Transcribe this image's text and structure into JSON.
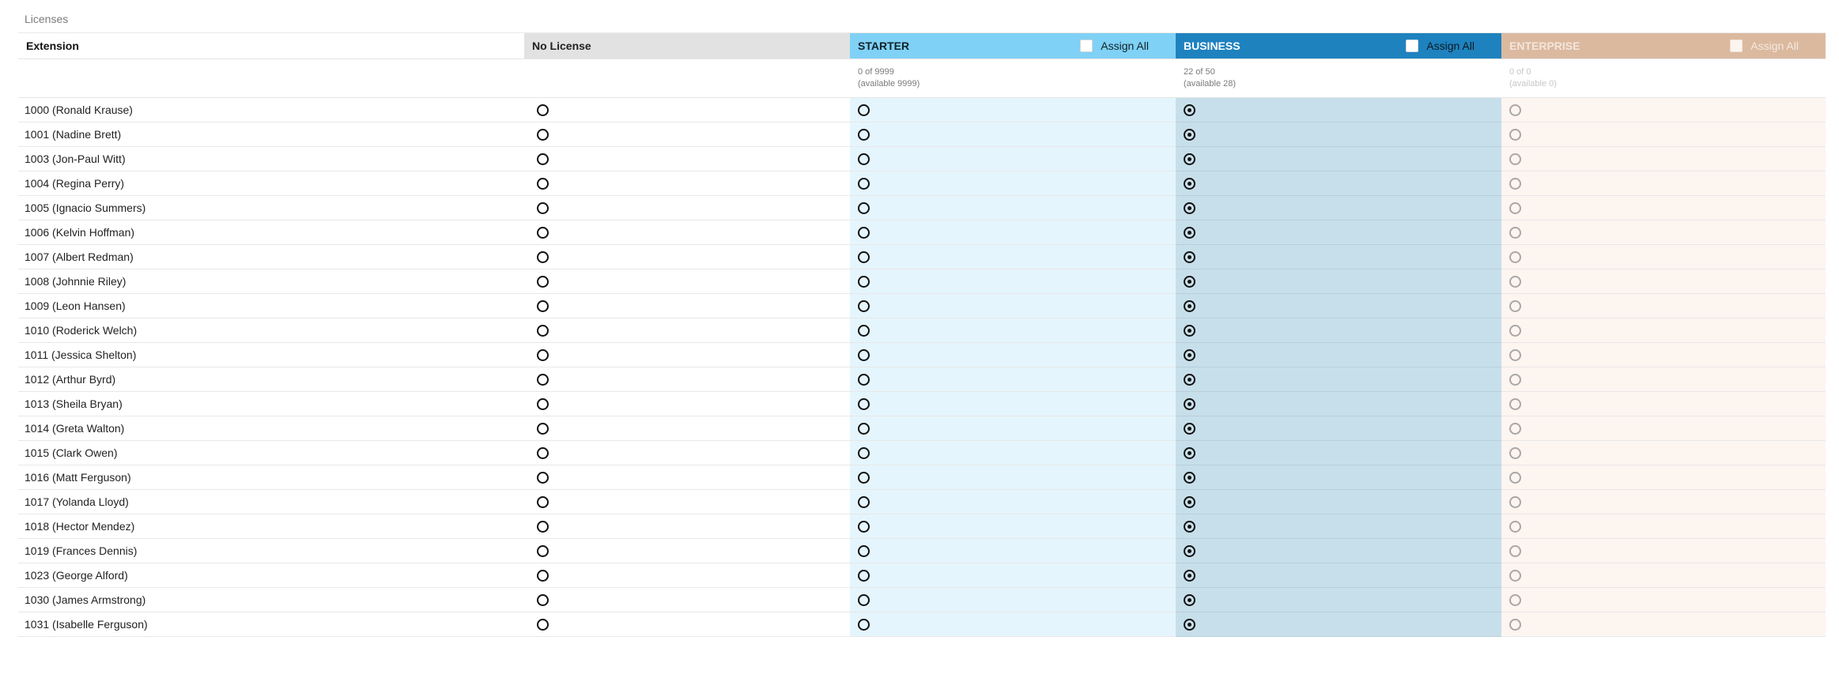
{
  "section_title": "Licenses",
  "headers": {
    "extension": "Extension",
    "none": "No License",
    "starter": "STARTER",
    "business": "BUSINESS",
    "enterprise": "ENTERPRISE",
    "assign_all": "Assign All"
  },
  "colors": {
    "starter": "#7fd1f5",
    "business": "#1e82bf",
    "enterprise": "#dbb99f",
    "no_license": "#e2e2e2"
  },
  "counts": {
    "starter": {
      "used": "0 of 9999",
      "available": "(available 9999)"
    },
    "business": {
      "used": "22 of 50",
      "available": "(available 28)"
    },
    "enterprise": {
      "used": "0 of 0",
      "available": "(available 0)"
    }
  },
  "rows": [
    {
      "extension": "1000 (Ronald Krause)",
      "license": "business"
    },
    {
      "extension": "1001 (Nadine Brett)",
      "license": "business"
    },
    {
      "extension": "1003 (Jon-Paul Witt)",
      "license": "business"
    },
    {
      "extension": "1004 (Regina Perry)",
      "license": "business"
    },
    {
      "extension": "1005 (Ignacio Summers)",
      "license": "business"
    },
    {
      "extension": "1006 (Kelvin Hoffman)",
      "license": "business"
    },
    {
      "extension": "1007 (Albert Redman)",
      "license": "business"
    },
    {
      "extension": "1008 (Johnnie Riley)",
      "license": "business"
    },
    {
      "extension": "1009 (Leon Hansen)",
      "license": "business"
    },
    {
      "extension": "1010 (Roderick Welch)",
      "license": "business"
    },
    {
      "extension": "1011 (Jessica Shelton)",
      "license": "business"
    },
    {
      "extension": "1012 (Arthur Byrd)",
      "license": "business"
    },
    {
      "extension": "1013 (Sheila Bryan)",
      "license": "business"
    },
    {
      "extension": "1014 (Greta Walton)",
      "license": "business"
    },
    {
      "extension": "1015 (Clark Owen)",
      "license": "business"
    },
    {
      "extension": "1016 (Matt Ferguson)",
      "license": "business"
    },
    {
      "extension": "1017 (Yolanda Lloyd)",
      "license": "business"
    },
    {
      "extension": "1018 (Hector Mendez)",
      "license": "business"
    },
    {
      "extension": "1019 (Frances Dennis)",
      "license": "business"
    },
    {
      "extension": "1023 (George Alford)",
      "license": "business"
    },
    {
      "extension": "1030 (James Armstrong)",
      "license": "business"
    },
    {
      "extension": "1031 (Isabelle Ferguson)",
      "license": "business"
    }
  ]
}
